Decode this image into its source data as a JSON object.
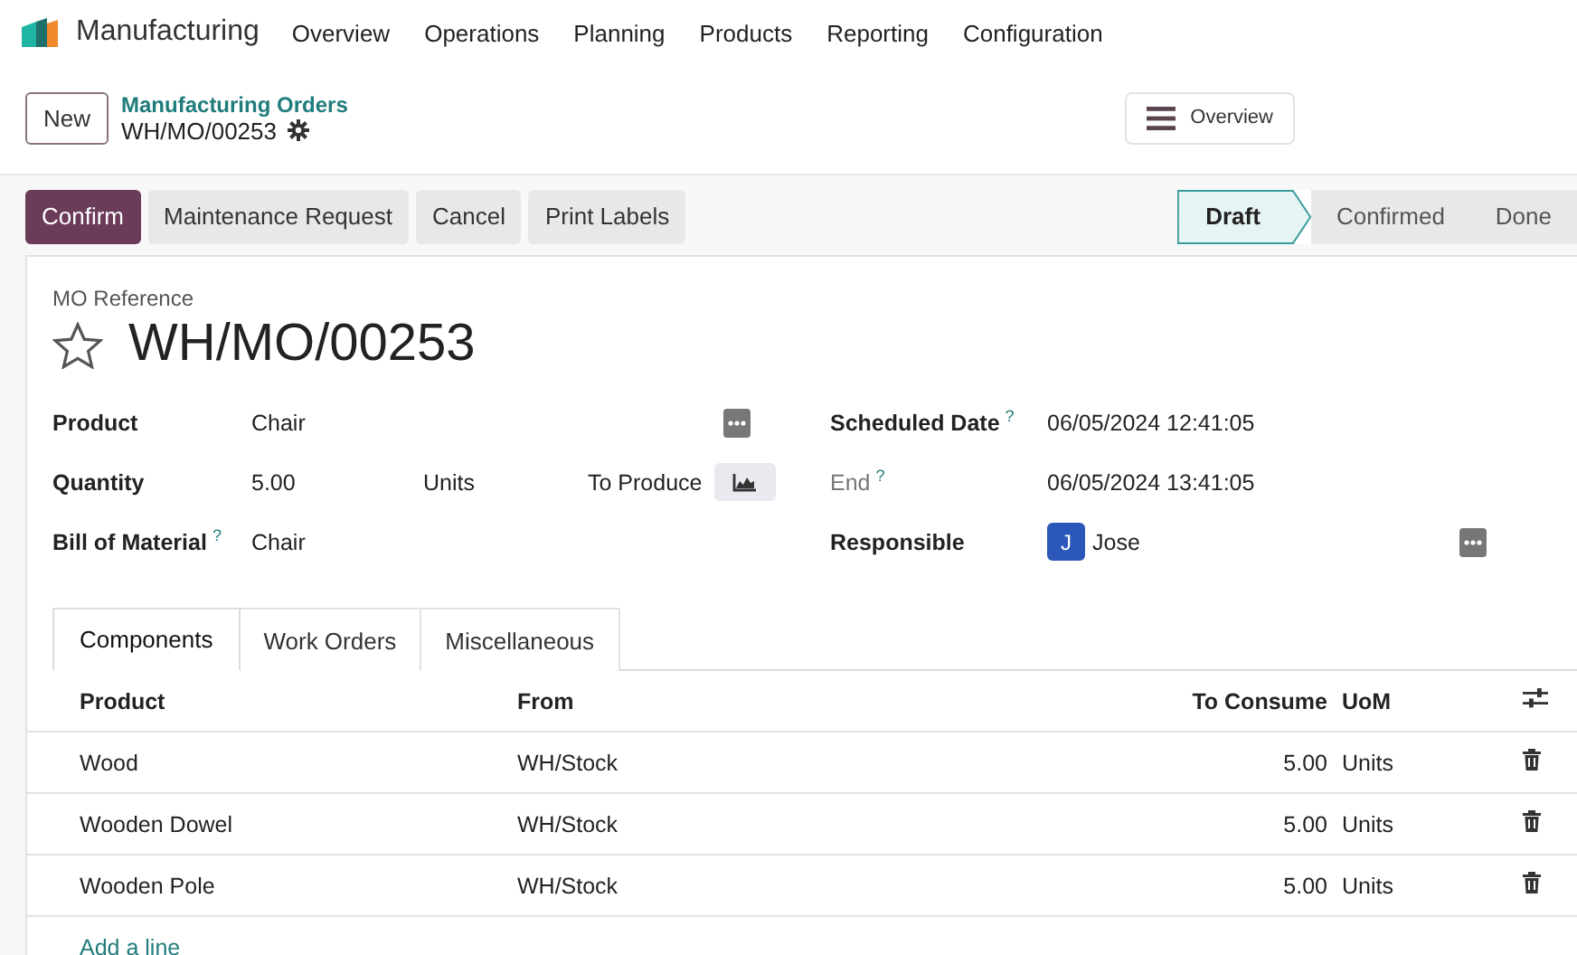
{
  "app": {
    "name": "Manufacturing"
  },
  "menu": [
    "Overview",
    "Operations",
    "Planning",
    "Products",
    "Reporting",
    "Configuration"
  ],
  "control_panel": {
    "new_button": "New",
    "breadcrumb": "Manufacturing Orders",
    "record": "WH/MO/00253",
    "overview_button": "Overview"
  },
  "actions": [
    {
      "label": "Confirm",
      "kind": "primary"
    },
    {
      "label": "Maintenance Request",
      "kind": "secondary"
    },
    {
      "label": "Cancel",
      "kind": "secondary"
    },
    {
      "label": "Print Labels",
      "kind": "secondary"
    }
  ],
  "stages": [
    {
      "label": "Draft",
      "selected": true
    },
    {
      "label": "Confirmed",
      "selected": false
    },
    {
      "label": "Done",
      "selected": false
    }
  ],
  "form": {
    "reference_label": "MO Reference",
    "reference": "WH/MO/00253",
    "starred": false,
    "left_fields": [
      {
        "label": "Product",
        "value": "Chair",
        "kind": "product"
      },
      {
        "label": "Quantity",
        "value": "5.00",
        "unit": "Units",
        "extra_label": "To Produce",
        "kind": "quantity"
      },
      {
        "label": "Bill of Material",
        "help": "?",
        "value": "Chair",
        "kind": "plain"
      }
    ],
    "right_fields": [
      {
        "label": "Scheduled Date",
        "help": "?",
        "value": "06/05/2024 12:41:05",
        "muted": false,
        "kind": "plain"
      },
      {
        "label": "End",
        "help": "?",
        "value": "06/05/2024 13:41:05",
        "muted": true,
        "kind": "plain"
      },
      {
        "label": "Responsible",
        "value": "Jose",
        "avatar": "J",
        "muted": false,
        "kind": "user"
      }
    ]
  },
  "tabs": [
    {
      "label": "Components",
      "selected": true
    },
    {
      "label": "Work Orders",
      "selected": false
    },
    {
      "label": "Miscellaneous",
      "selected": false
    }
  ],
  "table": {
    "columns": [
      "Product",
      "From",
      "To Consume",
      "UoM"
    ],
    "rows": [
      [
        "Wood",
        "WH/Stock",
        "5.00",
        "Units"
      ],
      [
        "Wooden Dowel",
        "WH/Stock",
        "5.00",
        "Units"
      ],
      [
        "Wooden Pole",
        "WH/Stock",
        "5.00",
        "Units"
      ]
    ],
    "add_line": "Add a line"
  }
}
